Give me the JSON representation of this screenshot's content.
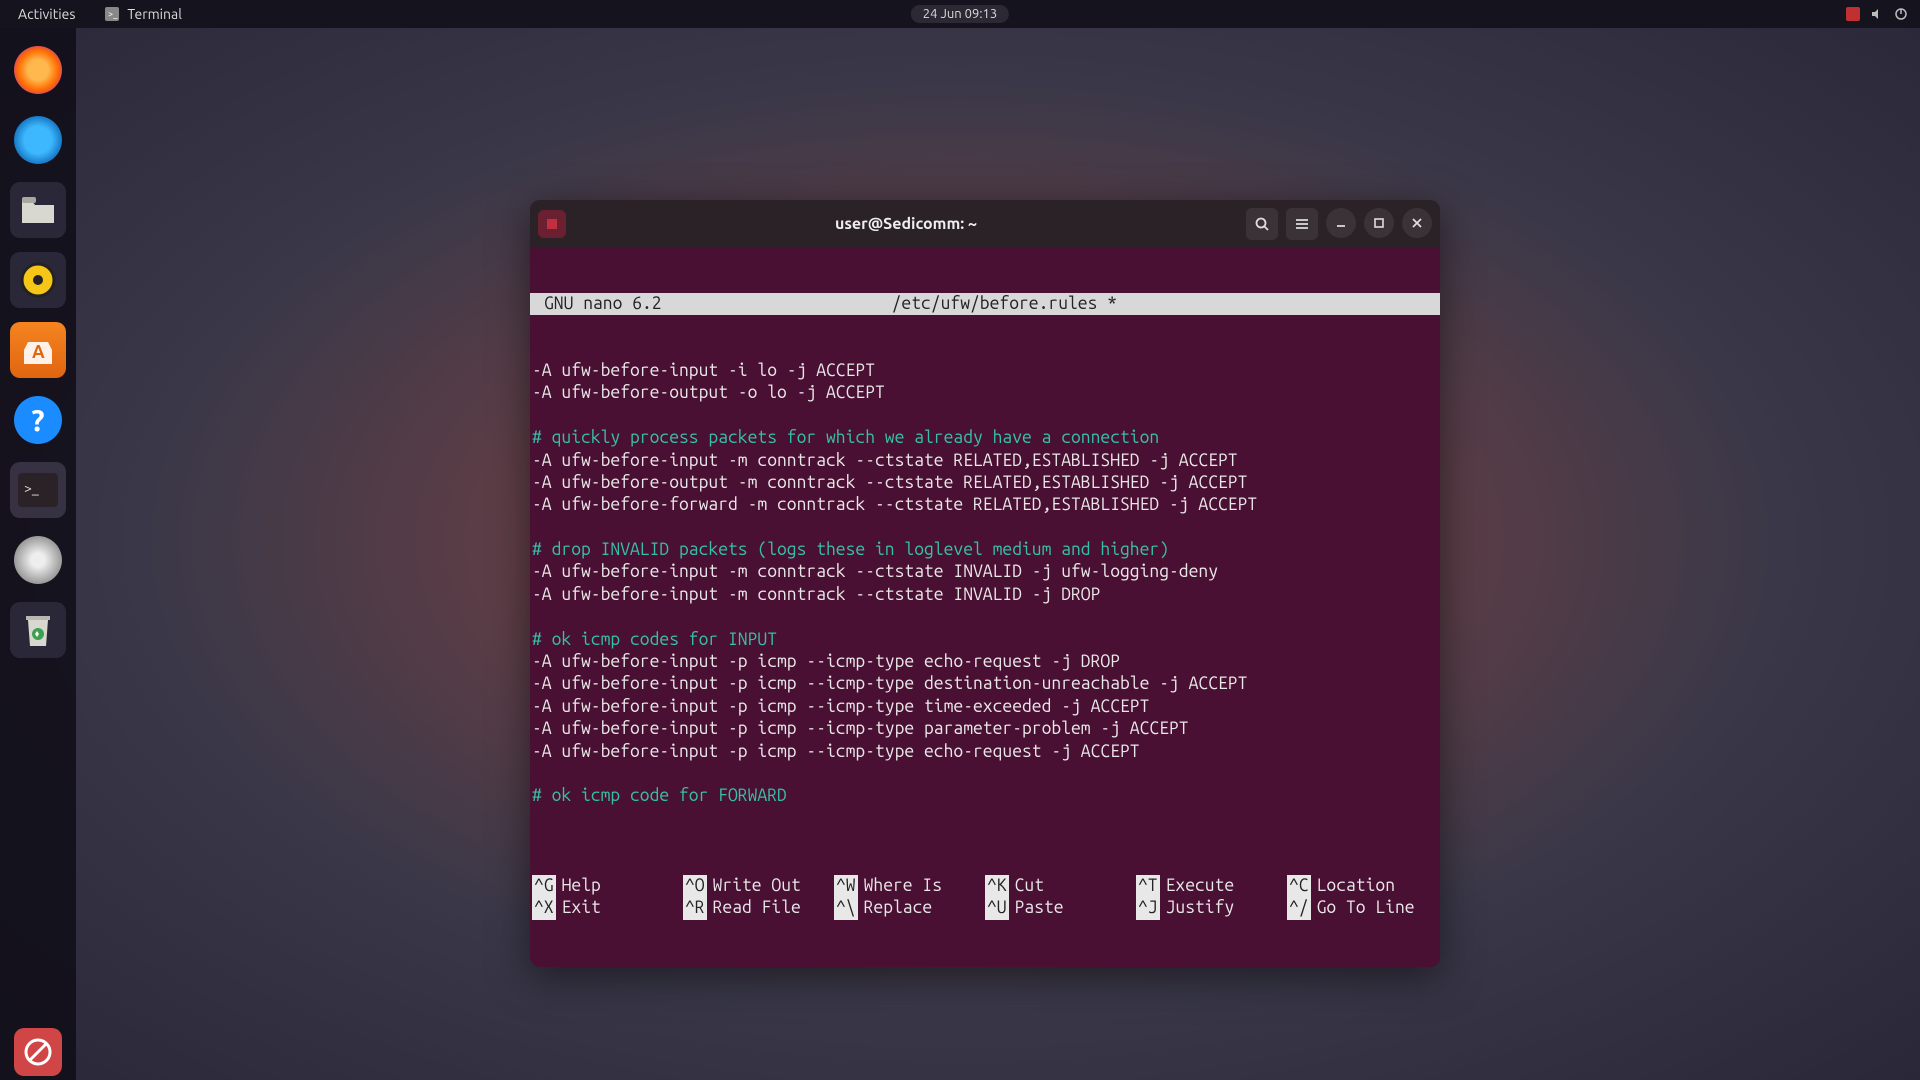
{
  "topbar": {
    "activities": "Activities",
    "app_name": "Terminal",
    "datetime": "24 Jun  09:13"
  },
  "dock": {
    "items": [
      {
        "name": "firefox",
        "glyph": ""
      },
      {
        "name": "thunderbird",
        "glyph": ""
      },
      {
        "name": "files",
        "glyph": "🗀"
      },
      {
        "name": "rhythmbox",
        "glyph": "◎"
      },
      {
        "name": "ubuntu-software",
        "glyph": "A"
      },
      {
        "name": "help",
        "glyph": "?"
      },
      {
        "name": "terminal",
        "glyph": ">_"
      },
      {
        "name": "disk",
        "glyph": "◉"
      },
      {
        "name": "trash",
        "glyph": "♻"
      }
    ],
    "bottom": {
      "name": "block",
      "glyph": "🚫"
    }
  },
  "terminal": {
    "title": "user@Sedicomm: ~",
    "nano": {
      "version": "GNU nano 6.2",
      "filepath": "/etc/ufw/before.rules *"
    },
    "content": [
      {
        "t": "cmd",
        "s": "-A ufw-before-input -i lo -j ACCEPT"
      },
      {
        "t": "cmd",
        "s": "-A ufw-before-output -o lo -j ACCEPT"
      },
      {
        "t": "blank",
        "s": ""
      },
      {
        "t": "comment",
        "s": "# quickly process packets for which we already have a connection"
      },
      {
        "t": "cmd",
        "s": "-A ufw-before-input -m conntrack --ctstate RELATED,ESTABLISHED -j ACCEPT"
      },
      {
        "t": "cmd",
        "s": "-A ufw-before-output -m conntrack --ctstate RELATED,ESTABLISHED -j ACCEPT"
      },
      {
        "t": "cmd",
        "s": "-A ufw-before-forward -m conntrack --ctstate RELATED,ESTABLISHED -j ACCEPT"
      },
      {
        "t": "blank",
        "s": ""
      },
      {
        "t": "comment",
        "s": "# drop INVALID packets (logs these in loglevel medium and higher)"
      },
      {
        "t": "cmd",
        "s": "-A ufw-before-input -m conntrack --ctstate INVALID -j ufw-logging-deny"
      },
      {
        "t": "cmd",
        "s": "-A ufw-before-input -m conntrack --ctstate INVALID -j DROP"
      },
      {
        "t": "blank",
        "s": ""
      },
      {
        "t": "comment",
        "s": "# ok icmp codes for INPUT"
      },
      {
        "t": "cmd",
        "s": "-A ufw-before-input -p icmp --icmp-type echo-request -j DROP"
      },
      {
        "t": "cmd",
        "s": "-A ufw-before-input -p icmp --icmp-type destination-unreachable -j ACCEPT"
      },
      {
        "t": "cmd",
        "s": "-A ufw-before-input -p icmp --icmp-type time-exceeded -j ACCEPT"
      },
      {
        "t": "cmd",
        "s": "-A ufw-before-input -p icmp --icmp-type parameter-problem -j ACCEPT"
      },
      {
        "t": "cmd",
        "s": "-A ufw-before-input -p icmp --icmp-type echo-request -j ACCEPT"
      },
      {
        "t": "blank",
        "s": ""
      },
      {
        "t": "comment",
        "s": "# ok icmp code for FORWARD"
      },
      {
        "t": "blank",
        "s": ""
      }
    ],
    "shortcuts": [
      {
        "key": "^G",
        "label": "Help"
      },
      {
        "key": "^O",
        "label": "Write Out"
      },
      {
        "key": "^W",
        "label": "Where Is"
      },
      {
        "key": "^K",
        "label": "Cut"
      },
      {
        "key": "^T",
        "label": "Execute"
      },
      {
        "key": "^C",
        "label": "Location"
      },
      {
        "key": "^X",
        "label": "Exit"
      },
      {
        "key": "^R",
        "label": "Read File"
      },
      {
        "key": "^\\",
        "label": "Replace"
      },
      {
        "key": "^U",
        "label": "Paste"
      },
      {
        "key": "^J",
        "label": "Justify"
      },
      {
        "key": "^/",
        "label": "Go To Line"
      }
    ]
  }
}
